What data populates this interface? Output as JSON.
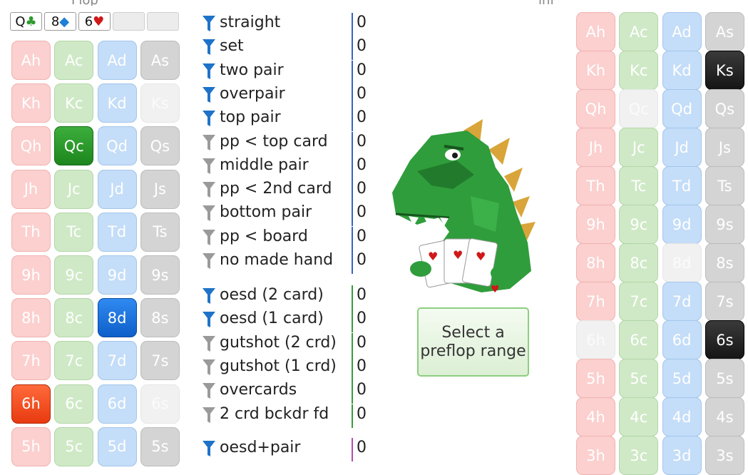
{
  "topbar": {
    "frag_left": "Flop",
    "frag_right": "inf"
  },
  "board": [
    {
      "rank": "Q",
      "suit": "♣",
      "suit_class": "suit-c"
    },
    {
      "rank": "8",
      "suit": "◆",
      "suit_class": "suit-d"
    },
    {
      "rank": "6",
      "suit": "♥",
      "suit_class": "suit-h"
    },
    {
      "rank": "",
      "suit": "",
      "suit_class": ""
    },
    {
      "rank": "",
      "suit": "",
      "suit_class": ""
    }
  ],
  "left_grid": {
    "rows": [
      [
        "Ah",
        "Ac",
        "Ad",
        "As"
      ],
      [
        "Kh",
        "Kc",
        "Kd",
        "Ks"
      ],
      [
        "Qh",
        "Qc",
        "Qd",
        "Qs"
      ],
      [
        "Jh",
        "Jc",
        "Jd",
        "Js"
      ],
      [
        "Th",
        "Tc",
        "Td",
        "Ts"
      ],
      [
        "9h",
        "9c",
        "9d",
        "9s"
      ],
      [
        "8h",
        "8c",
        "8d",
        "8s"
      ],
      [
        "7h",
        "7c",
        "7d",
        "7s"
      ],
      [
        "6h",
        "6c",
        "6d",
        "6s"
      ],
      [
        "5h",
        "5c",
        "5d",
        "5s"
      ]
    ],
    "selected": [
      "Qc",
      "8d",
      "6h"
    ],
    "used": [
      "Ks",
      "6s"
    ]
  },
  "right_grid": {
    "rows": [
      [
        "Ah",
        "Ac",
        "Ad",
        "As"
      ],
      [
        "Kh",
        "Kc",
        "Kd",
        "Ks"
      ],
      [
        "Qh",
        "Qc",
        "Qd",
        "Qs"
      ],
      [
        "Jh",
        "Jc",
        "Jd",
        "Js"
      ],
      [
        "Th",
        "Tc",
        "Td",
        "Ts"
      ],
      [
        "9h",
        "9c",
        "9d",
        "9s"
      ],
      [
        "8h",
        "8c",
        "8d",
        "8s"
      ],
      [
        "7h",
        "7c",
        "7d",
        "7s"
      ],
      [
        "6h",
        "6c",
        "6d",
        "6s"
      ],
      [
        "5h",
        "5c",
        "5d",
        "5s"
      ],
      [
        "4h",
        "4c",
        "4d",
        "4s"
      ],
      [
        "3h",
        "3c",
        "3d",
        "3s"
      ]
    ],
    "selected": [
      "Ks",
      "6s"
    ],
    "used": [
      "Qc",
      "8d",
      "6h"
    ]
  },
  "made_hands": [
    {
      "label": "straight",
      "value": "0",
      "active": true
    },
    {
      "label": "set",
      "value": "0",
      "active": true
    },
    {
      "label": "two pair",
      "value": "0",
      "active": true
    },
    {
      "label": "overpair",
      "value": "0",
      "active": true
    },
    {
      "label": "top pair",
      "value": "0",
      "active": true
    },
    {
      "label": "pp < top card",
      "value": "0",
      "active": false
    },
    {
      "label": "middle pair",
      "value": "0",
      "active": false
    },
    {
      "label": "pp < 2nd card",
      "value": "0",
      "active": false
    },
    {
      "label": "bottom pair",
      "value": "0",
      "active": false
    },
    {
      "label": "pp < board",
      "value": "0",
      "active": false
    },
    {
      "label": "no made hand",
      "value": "0",
      "active": false
    }
  ],
  "draws": [
    {
      "label": "oesd (2 card)",
      "value": "0",
      "active": true
    },
    {
      "label": "oesd (1 card)",
      "value": "0",
      "active": true
    },
    {
      "label": "gutshot (2 crd)",
      "value": "0",
      "active": false
    },
    {
      "label": "gutshot (1 crd)",
      "value": "0",
      "active": false
    },
    {
      "label": "overcards",
      "value": "0",
      "active": false
    },
    {
      "label": "2 crd bckdr fd",
      "value": "0",
      "active": false
    }
  ],
  "combos": [
    {
      "label": "oesd+pair",
      "value": "0",
      "active": true
    }
  ],
  "preflop_button": {
    "label": "Select a preflop range"
  },
  "colors": {
    "funnel_active": "#1e73c8",
    "funnel_inactive": "#9a9a9a",
    "sep_made": "#3a63c0",
    "sep_draws": "#3a9a3a",
    "sep_combos": "#b24ab2"
  }
}
